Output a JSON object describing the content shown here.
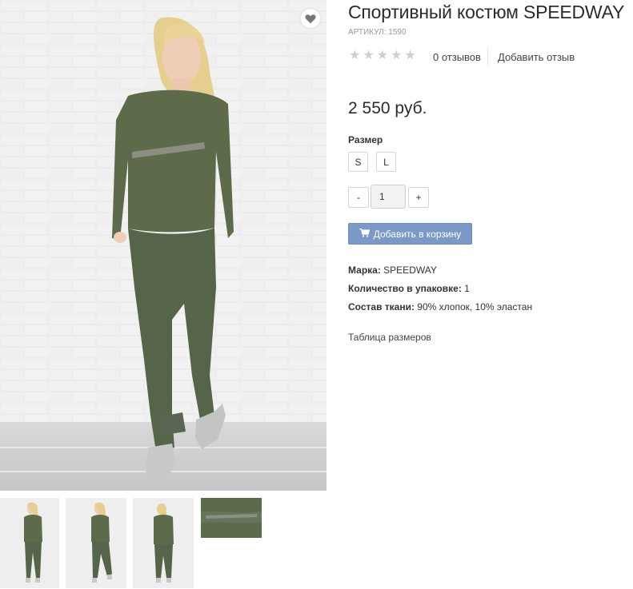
{
  "product": {
    "title": "Спортивный костюм SPEEDWAY",
    "sku": "АРТИКУЛ: 1590",
    "rating_stars": 0,
    "reviews_count": "0 отзывов",
    "add_review": "Добавить отзыв",
    "price": "2 550 руб.",
    "size_label": "Размер",
    "sizes": [
      "S",
      "L"
    ],
    "qty_minus": "-",
    "qty_value": "1",
    "qty_plus": "+",
    "cart_button": "Добавить в корзину",
    "cart_icon": "shopping-cart-icon",
    "wishlist_icon": "heart-icon",
    "props": [
      {
        "label": "Марка:",
        "value": "SPEEDWAY"
      },
      {
        "label": "Количество в упаковке:",
        "value": "1"
      },
      {
        "label": "Состав ткани:",
        "value": "90% хлопок, 10% эластан"
      }
    ],
    "size_table_link": "Таблица размеров"
  },
  "colors": {
    "accent_button": "#7b98c9",
    "garment_green": "#5d6b4a",
    "star_empty": "#cfcfcf"
  }
}
